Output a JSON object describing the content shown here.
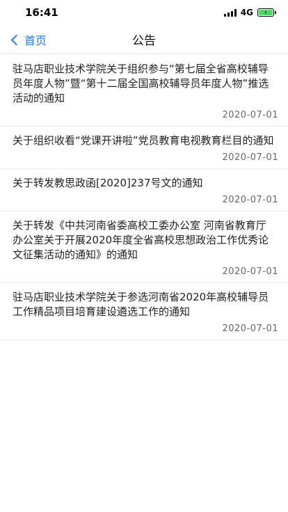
{
  "status": {
    "time": "16:41",
    "network": "4G",
    "battery_color": "#4cd964"
  },
  "nav": {
    "back_label": "首页",
    "title": "公告"
  },
  "notices": [
    {
      "title": "驻马店职业技术学院关于组织参与“第七届全省高校辅导员年度人物”暨“第十二届全国高校辅导员年度人物”推选活动的通知",
      "date": "2020-07-01"
    },
    {
      "title": "关于组织收看“党课开讲啦”党员教育电视教育栏目的通知",
      "date": "2020-07-01"
    },
    {
      "title": "关于转发教思政函[2020]237号文的通知",
      "date": "2020-07-01"
    },
    {
      "title": "关于转发《中共河南省委高校工委办公室 河南省教育厅办公室关于开展2020年度全省高校思想政治工作优秀论文征集活动的通知》的通知",
      "date": "2020-07-01"
    },
    {
      "title": "驻马店职业技术学院关于参选河南省2020年高校辅导员工作精品项目培育建设遴选工作的通知",
      "date": "2020-07-01"
    }
  ]
}
